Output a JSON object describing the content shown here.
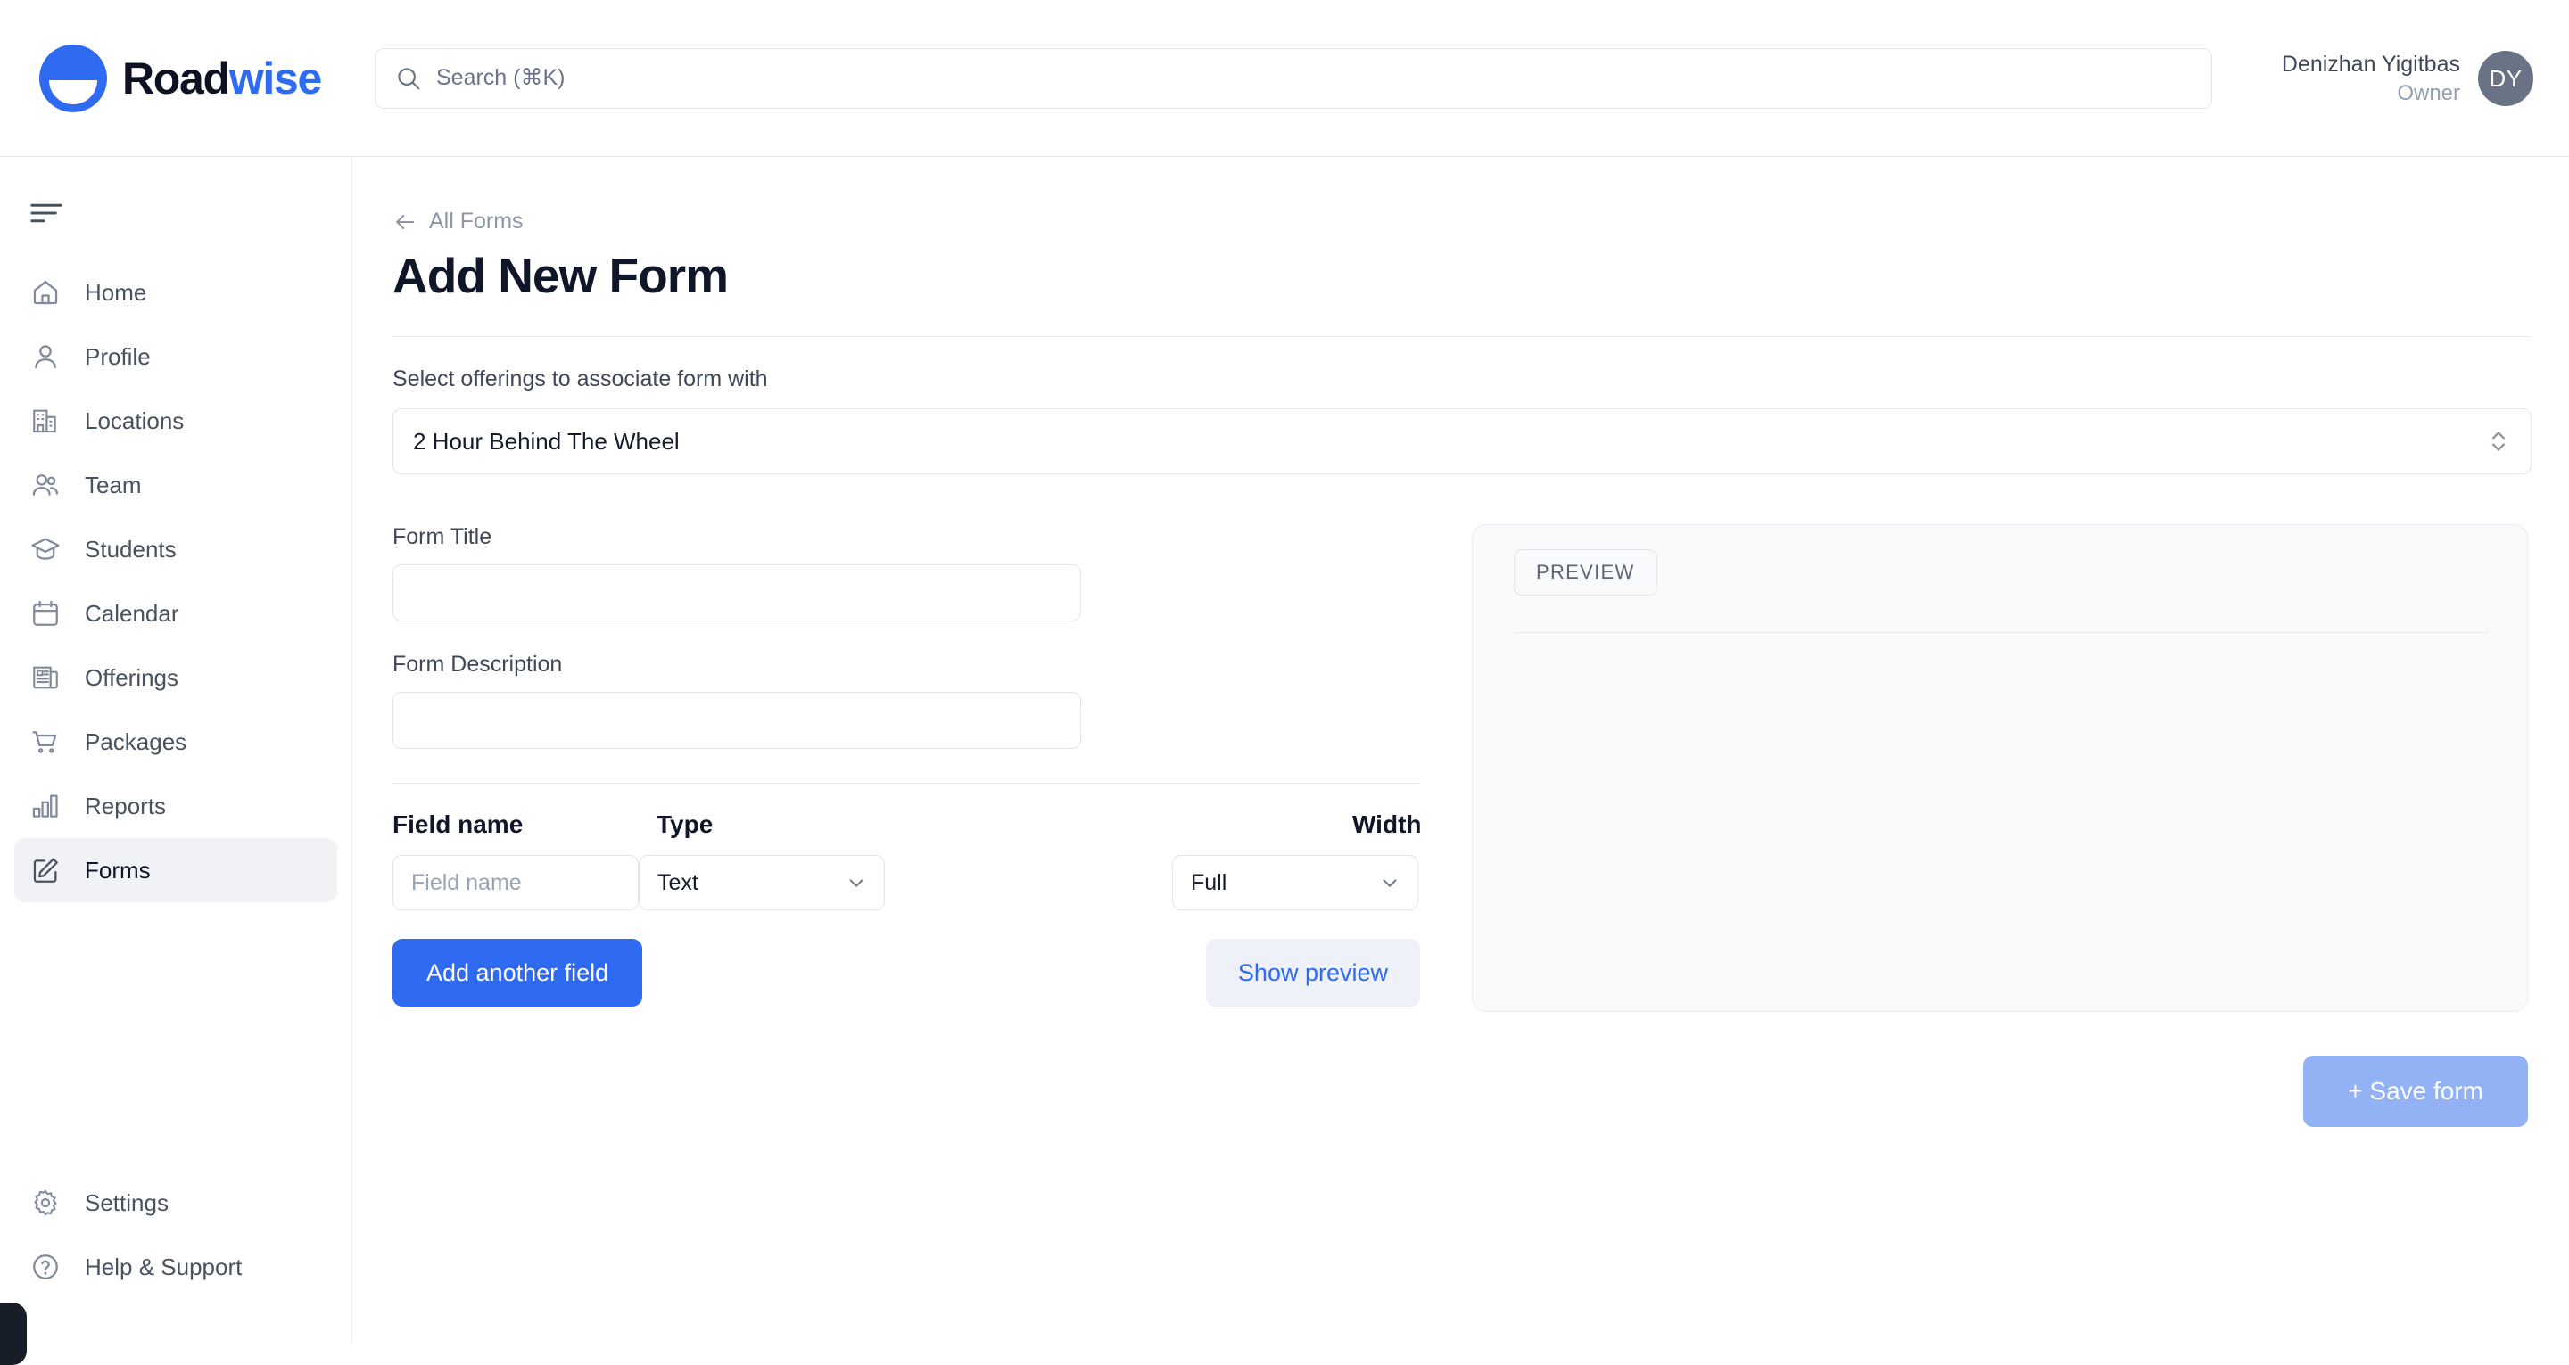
{
  "brand": {
    "name_dark": "Road",
    "name_accent": "wise",
    "logo_color": "#2f6bf0"
  },
  "search": {
    "placeholder": "Search (⌘K)",
    "value": ""
  },
  "user": {
    "name": "Denizhan Yigitbas",
    "role": "Owner",
    "initials": "DY"
  },
  "sidebar": {
    "items": [
      {
        "label": "Home",
        "icon": "home-icon",
        "active": false
      },
      {
        "label": "Profile",
        "icon": "user-icon",
        "active": false
      },
      {
        "label": "Locations",
        "icon": "building-icon",
        "active": false
      },
      {
        "label": "Team",
        "icon": "users-icon",
        "active": false
      },
      {
        "label": "Students",
        "icon": "graduation-icon",
        "active": false
      },
      {
        "label": "Calendar",
        "icon": "calendar-icon",
        "active": false
      },
      {
        "label": "Offerings",
        "icon": "newspaper-icon",
        "active": false
      },
      {
        "label": "Packages",
        "icon": "cart-icon",
        "active": false
      },
      {
        "label": "Reports",
        "icon": "bar-chart-icon",
        "active": false
      },
      {
        "label": "Forms",
        "icon": "edit-square-icon",
        "active": true
      }
    ],
    "bottom_items": [
      {
        "label": "Settings",
        "icon": "gear-icon"
      },
      {
        "label": "Help & Support",
        "icon": "question-circle-icon"
      }
    ]
  },
  "page": {
    "breadcrumb": "All Forms",
    "title": "Add New Form"
  },
  "offerings": {
    "label": "Select offerings to associate form with",
    "selected": "2 Hour Behind The Wheel"
  },
  "form": {
    "title_label": "Form Title",
    "title_value": "",
    "title_placeholder": "",
    "description_label": "Form Description",
    "description_value": "",
    "description_placeholder": ""
  },
  "field_table": {
    "headers": {
      "name": "Field name",
      "type": "Type",
      "width": "Width"
    },
    "row": {
      "name_value": "",
      "name_placeholder": "Field name",
      "type_selected": "Text",
      "width_selected": "Full"
    }
  },
  "actions": {
    "add_field": "Add another field",
    "show_preview": "Show preview",
    "save_form": "+ Save form"
  },
  "preview": {
    "badge": "PREVIEW"
  },
  "colors": {
    "primary": "#2f6bf0",
    "primary_disabled": "#93b2f5",
    "soft_bg": "#eef2f8",
    "panel_bg": "#f8fafc",
    "border": "#e2e6ec"
  }
}
